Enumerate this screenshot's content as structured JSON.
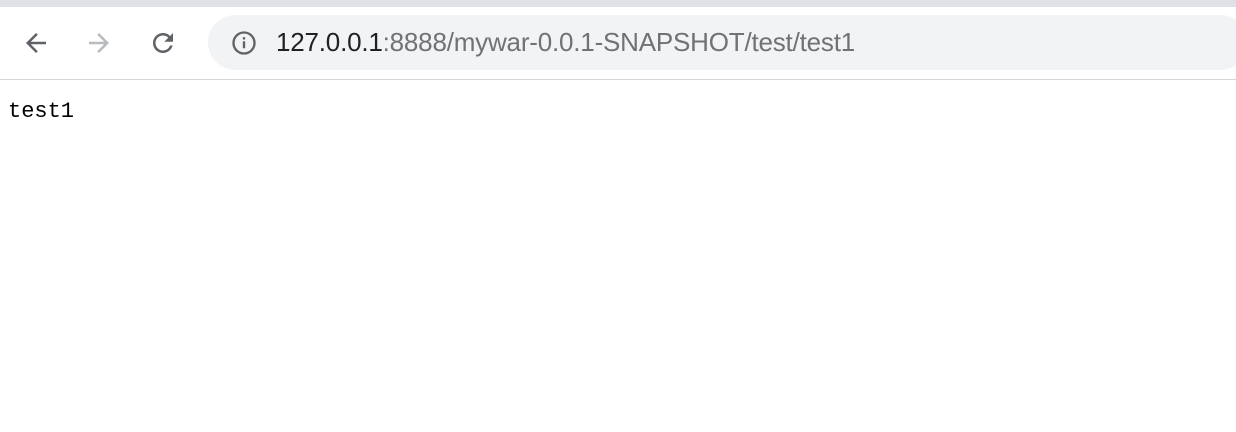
{
  "browser": {
    "url_host": "127.0.0.1",
    "url_rest": ":8888/mywar-0.0.1-SNAPSHOT/test/test1",
    "icons": {
      "back": "arrow-left-icon",
      "forward": "arrow-right-icon",
      "reload": "reload-icon",
      "site_info": "info-icon"
    },
    "colors": {
      "toolbar_bg": "#ffffff",
      "omnibox_bg": "#f1f3f4",
      "top_strip": "#dee1e6",
      "url_host": "#202124",
      "url_rest": "#6f7276",
      "icon_active": "#5f6368",
      "icon_disabled": "#b8bbbf"
    }
  },
  "page": {
    "body_text": "test1"
  }
}
